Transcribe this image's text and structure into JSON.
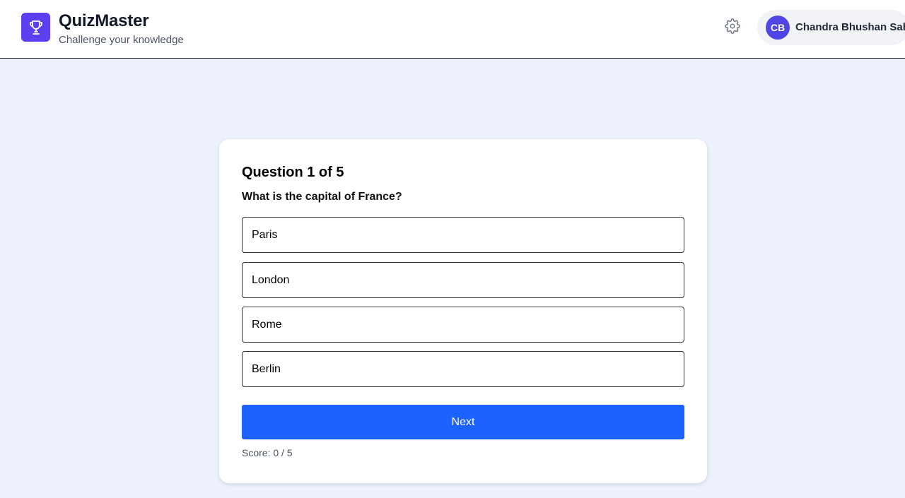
{
  "header": {
    "brand": {
      "logo_icon": "trophy-icon",
      "title": "QuizMaster",
      "subtitle": "Challenge your knowledge"
    },
    "settings_icon": "gear-icon",
    "user": {
      "initials": "CB",
      "name": "Chandra Bhushan Sah"
    }
  },
  "quiz": {
    "heading": "Question 1 of 5",
    "question": "What is the capital of France?",
    "options": [
      {
        "label": "Paris"
      },
      {
        "label": "London"
      },
      {
        "label": "Rome"
      },
      {
        "label": "Berlin"
      }
    ],
    "next_label": "Next",
    "score_text": "Score: 0 / 5"
  },
  "colors": {
    "accent": "#1b62ff",
    "brand": "#5b3ff0",
    "avatar": "#4f46e5",
    "page_background": "#edf1fc"
  }
}
